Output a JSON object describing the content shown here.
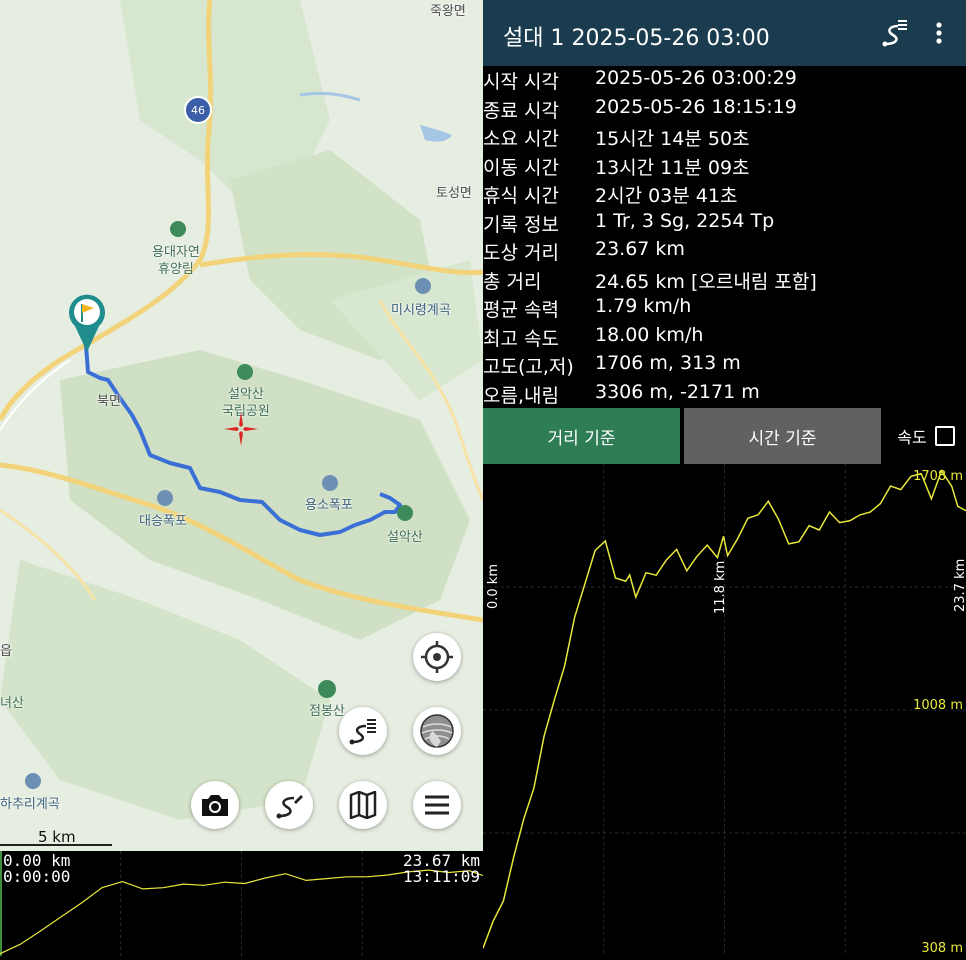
{
  "map": {
    "labels": {
      "jukwangmyeon": "죽왕면",
      "route46": "46",
      "toseongmyeon": "토성면",
      "yongdae": "용대자연",
      "yongdae2": "휴양림",
      "misiryeong": "미시령계곡",
      "seorak": "설악산",
      "seorak2": "국립공원",
      "bukmyeon": "북면",
      "yongso": "용소폭포",
      "daeseung": "대승폭포",
      "seoraksan_peak": "설악산",
      "jeombong": "점봉산",
      "hachuri": "하추리계곡",
      "edge1": "읍",
      "edge2": "녀산"
    },
    "scale_label": "5 km",
    "icons": [
      "start-flag-icon",
      "locate-icon",
      "track-list-icon",
      "layers-icon",
      "camera-icon",
      "track-edit-icon",
      "map-icon",
      "menu-icon"
    ],
    "track_color": "#3a6fd6"
  },
  "mini_profile": {
    "start_distance": "0.00 km",
    "start_time": "0:00:00",
    "end_distance": "23.67 km",
    "end_time": "13:11:09"
  },
  "header": {
    "title": "설대 1 2025-05-26 03:00",
    "icons": [
      "track-route-icon",
      "more-vert-icon"
    ]
  },
  "stats": [
    {
      "label": "시작 시각",
      "value": "2025-05-26 03:00:29"
    },
    {
      "label": "종료 시각",
      "value": "2025-05-26 18:15:19"
    },
    {
      "label": "소요 시간",
      "value": "15시간 14분 50초"
    },
    {
      "label": "이동 시간",
      "value": "13시간 11분 09초"
    },
    {
      "label": "휴식 시간",
      "value": "2시간 03분 41초"
    },
    {
      "label": "기록 정보",
      "value": "1 Tr, 3 Sg, 2254 Tp"
    },
    {
      "label": "도상 거리",
      "value": "23.67 km"
    },
    {
      "label": "총 거리",
      "value": "24.65 km [오르내림 포함]"
    },
    {
      "label": "평균 속력",
      "value": "1.79 km/h"
    },
    {
      "label": "최고 속도",
      "value": "18.00 km/h"
    },
    {
      "label": "고도(고,저)",
      "value": "1706 m, 313 m"
    },
    {
      "label": "오름,내림",
      "value": "3306 m, -2171 m"
    }
  ],
  "tabs": {
    "distance": "거리 기준",
    "time": "시간 기준",
    "speed": "속도",
    "speed_checked": false,
    "active": "distance",
    "active_color": "#2e7d55",
    "inactive_color": "#616161"
  },
  "chart_data": {
    "type": "line",
    "title": "",
    "xlabel": "",
    "ylabel": "",
    "x_unit": "km",
    "y_unit": "m",
    "xlim": [
      0,
      23.7
    ],
    "ylim": [
      308,
      1708
    ],
    "tick_labels": {
      "y_top": "1708 m",
      "y_mid": "1008 m",
      "y_bottom": "308 m",
      "x_start": "0.0 km",
      "x_mid": "11.8 km",
      "x_end": "23.7 km"
    },
    "grid": true,
    "line_color": "#e8e83a",
    "series": [
      {
        "x": [
          0,
          0.5,
          1,
          1.5,
          2,
          2.5,
          3,
          3.5,
          4,
          4.5,
          5,
          5.5,
          6,
          6.5,
          7,
          7.2,
          7.5,
          8,
          8.5,
          9,
          9.5,
          10,
          10.5,
          11,
          11.5,
          11.8,
          12,
          12.5,
          13,
          13.5,
          14,
          14.5,
          15,
          15.5,
          16,
          16.5,
          17,
          17.5,
          18,
          18.5,
          19,
          19.5,
          20,
          20.5,
          21,
          21.5,
          22,
          22.5,
          23,
          23.3,
          23.7
        ],
        "y": [
          313,
          380,
          470,
          570,
          690,
          800,
          920,
          1050,
          1150,
          1270,
          1400,
          1480,
          1500,
          1420,
          1380,
          1410,
          1360,
          1400,
          1420,
          1460,
          1470,
          1440,
          1460,
          1490,
          1480,
          1510,
          1470,
          1530,
          1560,
          1600,
          1630,
          1560,
          1520,
          1500,
          1550,
          1560,
          1580,
          1570,
          1580,
          1570,
          1610,
          1620,
          1660,
          1680,
          1690,
          1706,
          1650,
          1700,
          1680,
          1620,
          1600
        ]
      }
    ]
  },
  "mini_chart_data": {
    "type": "line",
    "xlim": [
      0,
      23.67
    ],
    "ylim": [
      308,
      1708
    ],
    "line_color": "#e8e83a",
    "series": [
      {
        "x": [
          0,
          1,
          2,
          3,
          4,
          5,
          6,
          7,
          8,
          9,
          10,
          11,
          12,
          13,
          14,
          15,
          16,
          17,
          18,
          19,
          20,
          21,
          22,
          23,
          23.67
        ],
        "y": [
          313,
          470,
          690,
          920,
          1150,
          1400,
          1500,
          1380,
          1400,
          1460,
          1440,
          1490,
          1470,
          1560,
          1630,
          1520,
          1550,
          1580,
          1580,
          1610,
          1660,
          1690,
          1650,
          1680,
          1600
        ]
      }
    ]
  }
}
